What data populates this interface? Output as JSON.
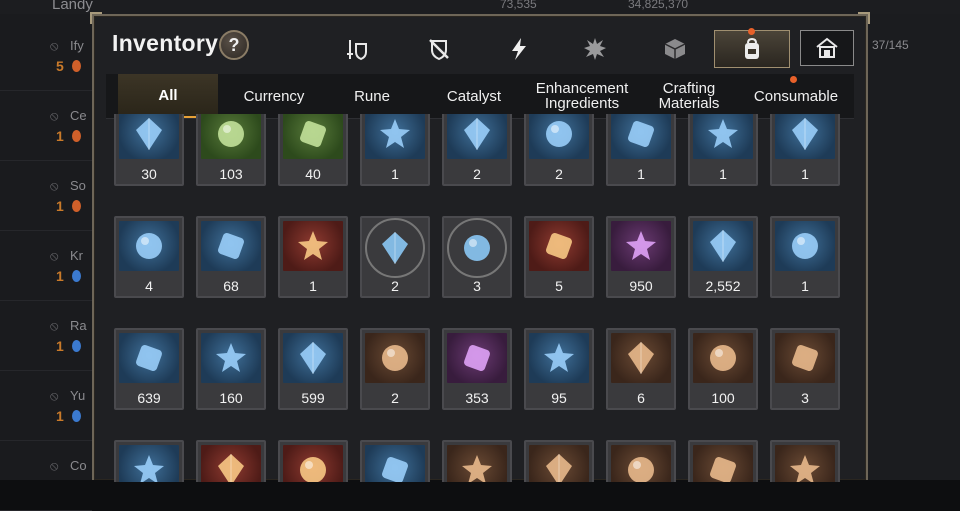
{
  "background": {
    "title": "Landy",
    "gold_text": "73,535",
    "gems_text": "34,825,370",
    "slots": "37/145",
    "list": [
      {
        "name": "Ify",
        "num": "5",
        "drop": "fire"
      },
      {
        "name": "Ce",
        "num": "1",
        "drop": "fire"
      },
      {
        "name": "So",
        "num": "1",
        "drop": "fire"
      },
      {
        "name": "Kr",
        "num": "1",
        "drop": "water"
      },
      {
        "name": "Ra",
        "num": "1",
        "drop": "water"
      },
      {
        "name": "Yu",
        "num": "1",
        "drop": "water"
      },
      {
        "name": "Co",
        "num": "",
        "drop": ""
      }
    ]
  },
  "panel": {
    "title": "Inventory",
    "help": "?"
  },
  "top_icons": [
    {
      "icon": "equipment-icon"
    },
    {
      "icon": "artifact-icon"
    },
    {
      "icon": "lightning-icon"
    },
    {
      "icon": "splash-icon"
    },
    {
      "icon": "cube-icon"
    },
    {
      "icon": "backpack-icon",
      "active": true
    },
    {
      "icon": "storage-house-icon"
    }
  ],
  "tabs": [
    {
      "label": "All",
      "active": true
    },
    {
      "label": "Currency"
    },
    {
      "label": "Rune"
    },
    {
      "label": "Catalyst"
    },
    {
      "label": "Enhancement Ingredients"
    },
    {
      "label": "Crafting Materials"
    },
    {
      "label": "Consumable"
    }
  ],
  "items": [
    {
      "qty": "30",
      "icon": "horn-icon",
      "bg": "blue"
    },
    {
      "qty": "103",
      "icon": "rose-icon",
      "bg": "green"
    },
    {
      "qty": "40",
      "icon": "stone-icon",
      "bg": "green"
    },
    {
      "qty": "1",
      "icon": "amulet-icon",
      "bg": "blue"
    },
    {
      "qty": "2",
      "icon": "purple-orb-icon",
      "bg": "blue"
    },
    {
      "qty": "2",
      "icon": "crate-icon",
      "bg": "blue"
    },
    {
      "qty": "1",
      "icon": "feather-icon",
      "bg": "blue"
    },
    {
      "qty": "1",
      "icon": "sword-icon",
      "bg": "blue"
    },
    {
      "qty": "1",
      "icon": "ring-icon",
      "bg": "blue"
    },
    {
      "qty": "4",
      "icon": "dark-crystal-icon",
      "bg": "blue"
    },
    {
      "qty": "68",
      "icon": "quill-icon",
      "bg": "blue"
    },
    {
      "qty": "1",
      "icon": "green-gem-icon",
      "bg": "red"
    },
    {
      "qty": "2",
      "icon": "rune-orb-icon",
      "bg": "circle"
    },
    {
      "qty": "3",
      "icon": "crystal-orb-icon",
      "bg": "circle"
    },
    {
      "qty": "5",
      "icon": "gold-shard-icon",
      "bg": "red"
    },
    {
      "qty": "950",
      "icon": "red-ring-icon",
      "bg": "purple"
    },
    {
      "qty": "2,552",
      "icon": "blue-crystal-icon",
      "bg": "blue"
    },
    {
      "qty": "1",
      "icon": "pendant-icon",
      "bg": "blue"
    },
    {
      "qty": "639",
      "icon": "silver-coin-icon",
      "bg": "blue"
    },
    {
      "qty": "160",
      "icon": "cyan-crystal-icon",
      "bg": "blue"
    },
    {
      "qty": "599",
      "icon": "leaf-icon",
      "bg": "blue"
    },
    {
      "qty": "2",
      "icon": "card-icon",
      "bg": "brown"
    },
    {
      "qty": "353",
      "icon": "pink-pyramid-icon",
      "bg": "purple"
    },
    {
      "qty": "95",
      "icon": "star-charm-icon",
      "bg": "blue"
    },
    {
      "qty": "6",
      "icon": "lava-orb-icon",
      "bg": "brown"
    },
    {
      "qty": "100",
      "icon": "red-band-icon",
      "bg": "brown"
    },
    {
      "qty": "3",
      "icon": "cross-badge-icon",
      "bg": "brown"
    },
    {
      "qty": "",
      "icon": "green-heart-icon",
      "bg": "blue"
    },
    {
      "qty": "",
      "icon": "sun-medal-icon",
      "bg": "red"
    },
    {
      "qty": "",
      "icon": "gold-shield-icon",
      "bg": "red"
    },
    {
      "qty": "",
      "icon": "stone-tablet-icon",
      "bg": "blue"
    },
    {
      "qty": "",
      "icon": "fist-emblem-icon",
      "bg": "brown"
    },
    {
      "qty": "",
      "icon": "banner-icon",
      "bg": "brown"
    },
    {
      "qty": "",
      "icon": "horse-head-icon",
      "bg": "brown"
    },
    {
      "qty": "",
      "icon": "red-mask-icon",
      "bg": "brown"
    },
    {
      "qty": "",
      "icon": "clover-icon",
      "bg": "brown"
    }
  ]
}
